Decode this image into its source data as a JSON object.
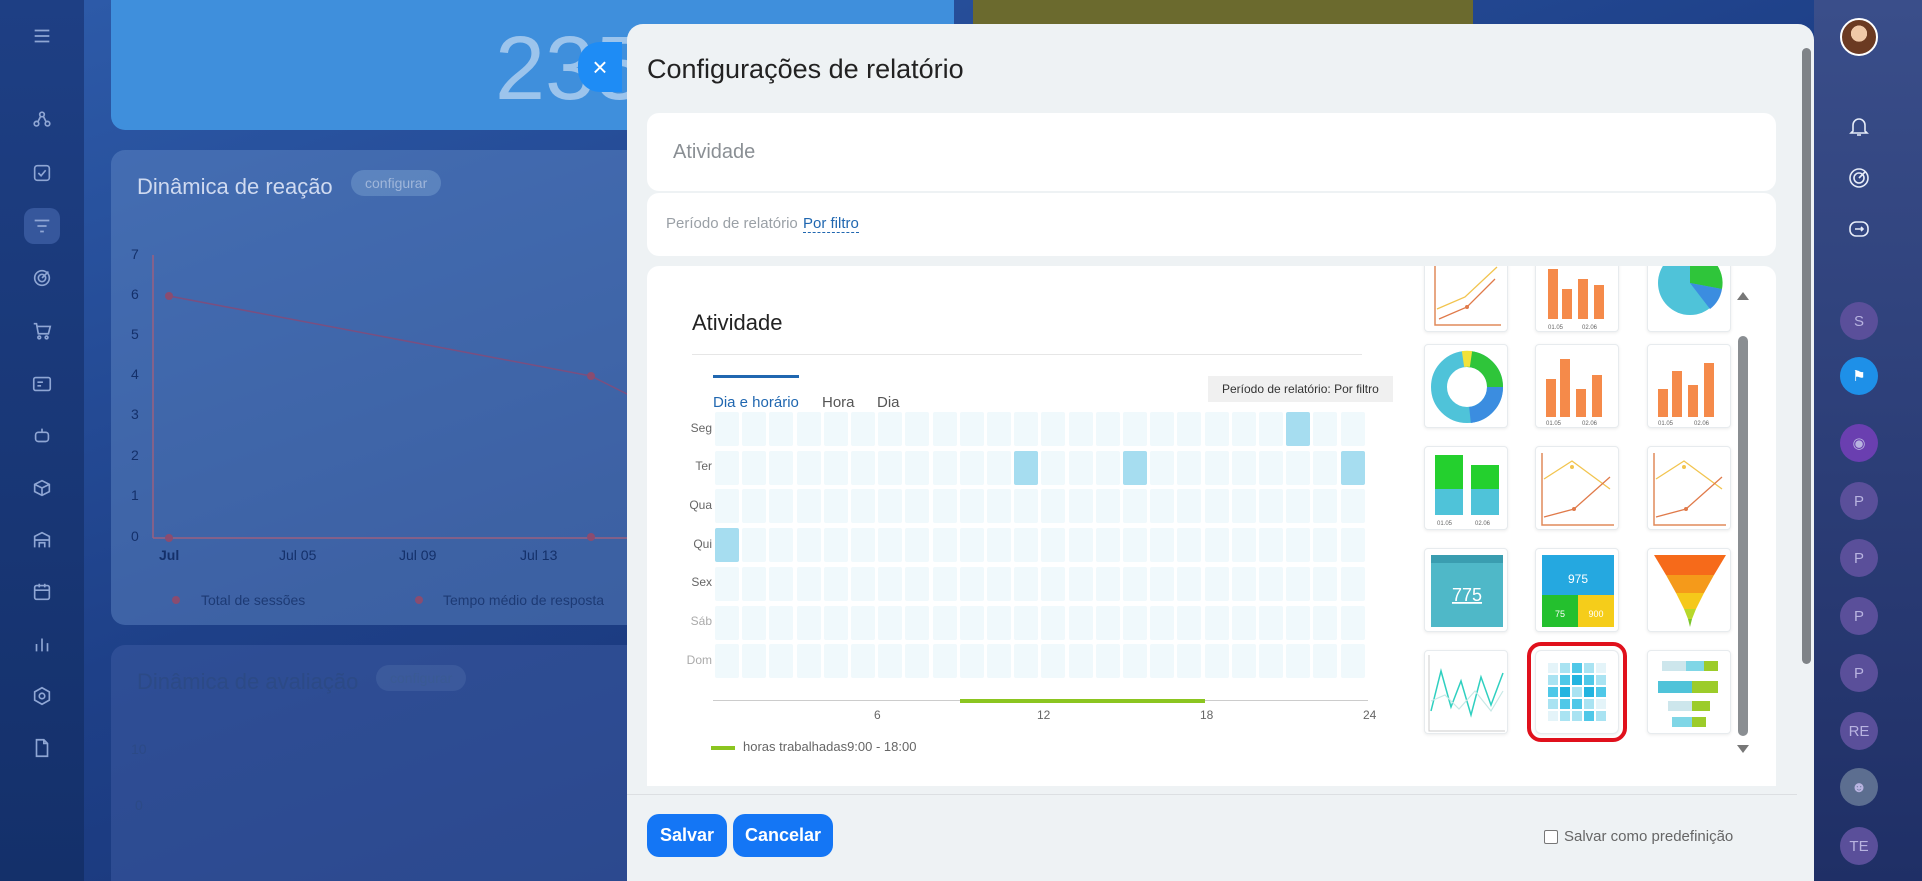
{
  "background": {
    "big_number": "235",
    "card1": {
      "title": "Dinâmica de reação",
      "configure": "configurar",
      "y_ticks": [
        "7",
        "6",
        "5",
        "4",
        "3",
        "2",
        "1",
        "0"
      ],
      "x_ticks": [
        "Jul",
        "Jul 05",
        "Jul 09",
        "Jul 13"
      ],
      "legend": [
        "Total de sessões",
        "Tempo médio de resposta"
      ]
    },
    "card2": {
      "title": "Dinâmica de avaliação",
      "configure": "configurar",
      "y_ticks": [
        "10",
        "0"
      ]
    },
    "right_rail": {
      "avatars": [
        "S",
        "P",
        "P",
        "P",
        "P",
        "RE",
        "TE"
      ]
    }
  },
  "modal": {
    "title": "Configurações de relatório",
    "report_name_value": "Atividade",
    "period_label": "Período de relatório",
    "period_value": "Por filtro",
    "preview": {
      "title": "Atividade",
      "tabs": [
        "Dia e horário",
        "Hora",
        "Dia"
      ],
      "active_tab": "Dia e horário",
      "period_badge": "Período de relatório: Por filtro",
      "days": [
        "Seg",
        "Ter",
        "Qua",
        "Qui",
        "Sex",
        "Sáb",
        "Dom"
      ],
      "x_ticks": [
        "6",
        "12",
        "18",
        "24"
      ],
      "legend_label": "horas trabalhadas",
      "legend_hours": "9:00 - 18:00",
      "highlighted_cells": [
        {
          "day": "Seg",
          "hour": 21
        },
        {
          "day": "Ter",
          "hour": 11
        },
        {
          "day": "Ter",
          "hour": 15
        },
        {
          "day": "Ter",
          "hour": 23
        },
        {
          "day": "Qui",
          "hour": 0
        }
      ],
      "work_hours": [
        9,
        18
      ]
    },
    "gallery": {
      "thumb_texts": {
        "bar_dates": [
          "01.05",
          "02.06"
        ],
        "number_big": "775",
        "number_small_a": "975",
        "number_small_b": "75",
        "number_small_c": "900"
      },
      "selected": "heatmap"
    },
    "footer": {
      "save": "Salvar",
      "cancel": "Cancelar",
      "preset_label": "Salvar como predefinição"
    }
  }
}
